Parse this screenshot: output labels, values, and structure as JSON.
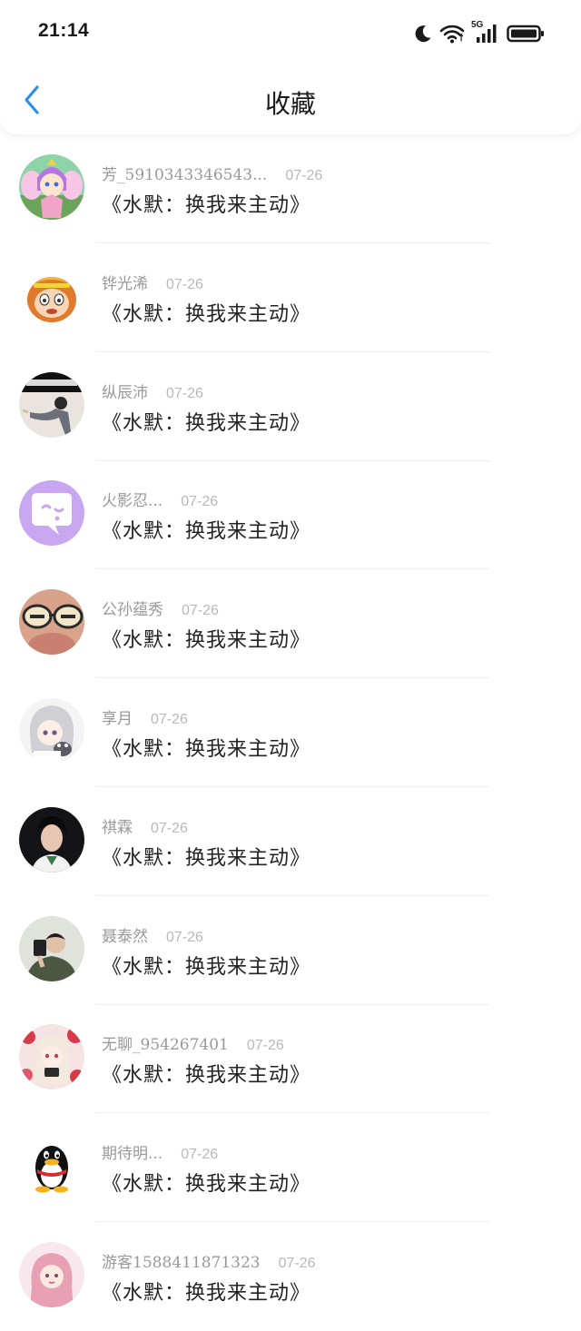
{
  "status_bar": {
    "time": "21:14",
    "network": "5G"
  },
  "header": {
    "title": "收藏"
  },
  "items": [
    {
      "user": "芳_5910343346543...",
      "date": "07-26",
      "title": "《水默：换我来主动》",
      "avatar": "fairy-avatar"
    },
    {
      "user": "铧光浠",
      "date": "07-26",
      "title": "《水默：换我来主动》",
      "avatar": "monkey-king-avatar"
    },
    {
      "user": "纵辰沛",
      "date": "07-26",
      "title": "《水默：换我来主动》",
      "avatar": "dancer-avatar"
    },
    {
      "user": "火影忍...",
      "date": "07-26",
      "title": "《水默：换我来主动》",
      "avatar": "chat-bubble-avatar"
    },
    {
      "user": "公孙蕴秀",
      "date": "07-26",
      "title": "《水默：换我来主动》",
      "avatar": "glasses-avatar"
    },
    {
      "user": "享月",
      "date": "07-26",
      "title": "《水默：换我来主动》",
      "avatar": "anime-girl-avatar"
    },
    {
      "user": "祺霖",
      "date": "07-26",
      "title": "《水默：换我来主动》",
      "avatar": "portrait-avatar"
    },
    {
      "user": "聂泰然",
      "date": "07-26",
      "title": "《水默：换我来主动》",
      "avatar": "selfie-avatar"
    },
    {
      "user": "无聊_954267401",
      "date": "07-26",
      "title": "《水默：换我来主动》",
      "avatar": "floral-girl-avatar"
    },
    {
      "user": "期待明...",
      "date": "07-26",
      "title": "《水默：换我来主动》",
      "avatar": "qq-penguin-avatar"
    },
    {
      "user": "游客1588411871323",
      "date": "07-26",
      "title": "《水默：换我来主动》",
      "avatar": "pink-girl-avatar"
    }
  ],
  "colors": {
    "accent": "#2f8fe6",
    "meta_text": "#999999",
    "title_text": "#222222"
  }
}
